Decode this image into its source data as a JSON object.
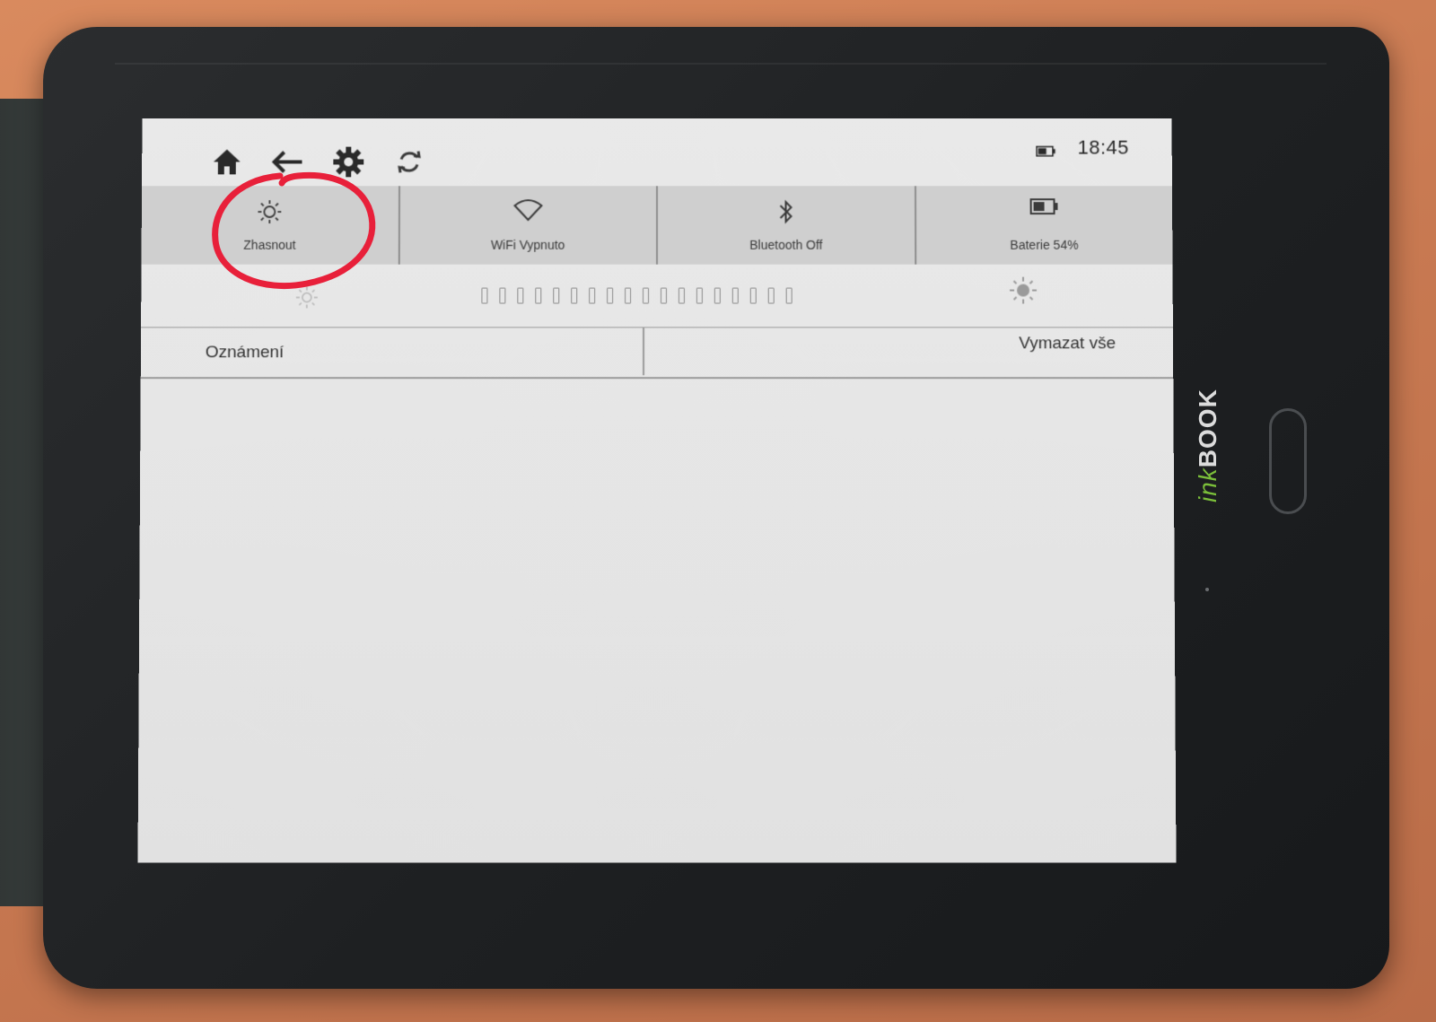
{
  "status": {
    "time": "18:45",
    "battery_icon": "battery-icon"
  },
  "nav": {
    "icons": [
      "home-icon",
      "back-icon",
      "settings-icon",
      "sync-icon"
    ]
  },
  "quick_settings": [
    {
      "label": "Zhasnout",
      "icon": "sun-icon"
    },
    {
      "label": "WiFi Vypnuto",
      "icon": "wifi-icon"
    },
    {
      "label": "Bluetooth Off",
      "icon": "bluetooth-icon"
    },
    {
      "label": "Baterie 54%",
      "icon": "battery-icon"
    }
  ],
  "brightness": {
    "levels": 18,
    "level": 0
  },
  "notifications": {
    "title": "Oznámení",
    "clear_all": "Vymazat vše"
  },
  "brand": {
    "ink": "ink",
    "book": "BOOK"
  },
  "colors": {
    "annotation": "#e8203a",
    "brand_accent": "#7bbf3a"
  }
}
